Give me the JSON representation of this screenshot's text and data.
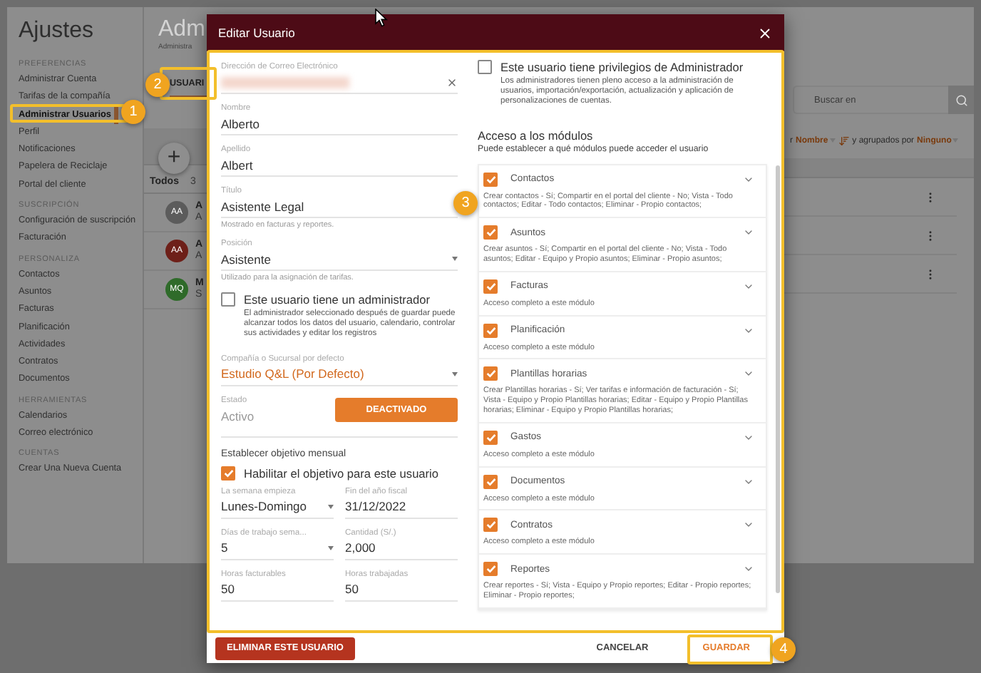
{
  "sidebar": {
    "title": "Ajustes",
    "sections": [
      {
        "heading": "PREFERENCIAS",
        "items": [
          {
            "label": "Administrar Cuenta",
            "selected": false
          },
          {
            "label": "Tarifas de la compañía",
            "selected": false
          },
          {
            "label": "Administrar Usuarios",
            "selected": true
          },
          {
            "label": "Perfil",
            "selected": false
          },
          {
            "label": "Notificaciones",
            "selected": false
          },
          {
            "label": "Papelera de Reciclaje",
            "selected": false
          },
          {
            "label": "Portal del cliente",
            "selected": false
          }
        ]
      },
      {
        "heading": "SUSCRIPCIÓN",
        "items": [
          {
            "label": "Configuración de suscripción",
            "selected": false
          },
          {
            "label": "Facturación",
            "selected": false
          }
        ]
      },
      {
        "heading": "PERSONALIZA",
        "items": [
          {
            "label": "Contactos",
            "selected": false
          },
          {
            "label": "Asuntos",
            "selected": false
          },
          {
            "label": "Facturas",
            "selected": false
          },
          {
            "label": "Planificación",
            "selected": false
          },
          {
            "label": "Actividades",
            "selected": false
          },
          {
            "label": "Contratos",
            "selected": false
          },
          {
            "label": "Documentos",
            "selected": false
          }
        ]
      },
      {
        "heading": "HERRAMIENTAS",
        "items": [
          {
            "label": "Calendarios",
            "selected": false
          },
          {
            "label": "Correo electrónico",
            "selected": false
          }
        ]
      },
      {
        "heading": "CUENTAS",
        "items": [
          {
            "label": "Crear Una Nueva Cuenta",
            "selected": false
          }
        ]
      }
    ]
  },
  "main": {
    "title": "Adm",
    "subtitle": "Administra",
    "tab": "USUARI",
    "add_button": "+",
    "filter": {
      "label": "Todos",
      "count": "3"
    },
    "users": [
      {
        "initials": "AA",
        "color": "#5c5c5c",
        "name": "A",
        "detail": "A"
      },
      {
        "initials": "AA",
        "color": "#6e2019",
        "name": "A",
        "detail": "A"
      },
      {
        "initials": "MQ",
        "color": "#2f6b2a",
        "name": "M",
        "detail": "S"
      }
    ],
    "search": {
      "placeholder": "Buscar en"
    },
    "sort": {
      "prefix": "r",
      "field": "Nombre",
      "group_label": "y agrupados por",
      "group": "Ninguno"
    }
  },
  "dialog": {
    "title": "Editar Usuario",
    "fields": [
      {
        "kind": "redacted",
        "label": "Dirección de Correo Electrónico"
      },
      {
        "kind": "text",
        "label": "Nombre",
        "value": "Alberto"
      },
      {
        "kind": "text",
        "label": "Apellido",
        "value": "Albert"
      },
      {
        "kind": "text",
        "label": "Título",
        "value": "Asistente Legal",
        "hint": "Mostrado en facturas y reportes."
      },
      {
        "kind": "select",
        "label": "Posición",
        "value": "Asistente",
        "hint": "Utilizado para la asignación de tarifas."
      }
    ],
    "manager": {
      "label": "Este usuario tiene un administrador",
      "checked": false,
      "description": "El administrador seleccionado después de guardar puede alcanzar todos los datos del usuario, calendario, controlar sus actividades y editar los registros"
    },
    "company": {
      "label": "Compañía o Sucursal por defecto",
      "value": "Estudio Q&L (Por Defecto)"
    },
    "status": {
      "label": "Estado",
      "value": "Activo",
      "button": "DEACTIVADO"
    },
    "goal": {
      "heading": "Establecer objetivo mensual",
      "checkbox": {
        "label": "Habilitar el objetivo para este usuario",
        "checked": true
      },
      "fields": [
        {
          "kind": "select",
          "label": "La semana empieza",
          "value": "Lunes-Domingo"
        },
        {
          "kind": "text",
          "label": "Fin del año fiscal",
          "value": "31/12/2022"
        },
        {
          "kind": "select",
          "label": "Días de trabajo sema...",
          "value": "5"
        },
        {
          "kind": "text",
          "label": "Cantidad (S/.)",
          "value": "2,000"
        },
        {
          "kind": "text",
          "label": "Horas facturables",
          "value": "50"
        },
        {
          "kind": "text",
          "label": "Horas trabajadas",
          "value": "50"
        }
      ]
    },
    "admin": {
      "label": "Este usuario tiene privilegios de Administrador",
      "checked": false,
      "description": "Los administradores tienen pleno acceso a la administración de usuarios, importación/exportación, actualización y aplicación de personalizaciones de cuentas."
    },
    "modules": {
      "heading": "Acceso a los módulos",
      "subheading": "Puede establecer a qué módulos puede acceder el usuario",
      "items": [
        {
          "name": "Contactos",
          "checked": true,
          "description": "Crear contactos - Sí; Compartir en el portal del cliente - No; Vista - Todo contactos; Editar - Todo contactos; Eliminar - Propio contactos;"
        },
        {
          "name": "Asuntos",
          "checked": true,
          "description": "Crear asuntos - Sí; Compartir en el portal del cliente - No; Vista - Todo asuntos; Editar - Equipo y Propio asuntos; Eliminar - Propio asuntos;"
        },
        {
          "name": "Facturas",
          "checked": true,
          "description": "Acceso completo a este módulo"
        },
        {
          "name": "Planificación",
          "checked": true,
          "description": "Acceso completo a este módulo"
        },
        {
          "name": "Plantillas horarias",
          "checked": true,
          "description": "Crear Plantillas horarias - Sí; Ver tarifas e información de facturación - Sí; Vista - Equipo y Propio Plantillas horarias; Editar - Equipo y Propio Plantillas horarias; Eliminar - Equipo y Propio Plantillas horarias;"
        },
        {
          "name": "Gastos",
          "checked": true,
          "description": "Acceso completo a este módulo"
        },
        {
          "name": "Documentos",
          "checked": true,
          "description": "Acceso completo a este módulo"
        },
        {
          "name": "Contratos",
          "checked": true,
          "description": "Acceso completo a este módulo"
        },
        {
          "name": "Reportes",
          "checked": true,
          "description": "Crear reportes - Sí; Vista - Equipo y Propio reportes; Editar - Propio reportes; Eliminar - Propio reportes;"
        }
      ]
    },
    "footer": {
      "delete": "ELIMINAR ESTE USUARIO",
      "cancel": "CANCELAR",
      "save": "GUARDAR"
    }
  },
  "callouts": [
    "1",
    "2",
    "3",
    "4"
  ]
}
